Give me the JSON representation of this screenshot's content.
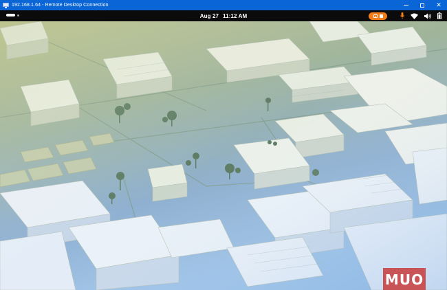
{
  "rdp_window": {
    "title": "192.168.1.64 - Remote Desktop Connection",
    "controls": {
      "minimize": "minimize",
      "maximize": "maximize",
      "close": "✕"
    }
  },
  "topbar": {
    "date": "Aug 27",
    "time": "11:12 AM",
    "tray": [
      "screen-record-indicator",
      "microphone-icon",
      "wifi-icon",
      "speaker-icon",
      "battery-icon"
    ]
  },
  "colors": {
    "titlebar": "#0a66d6",
    "topbar": "#0b0b0b",
    "record_indicator": "#f07d1a",
    "mic": "#f07d1a",
    "wallpaper_top": "#b7c28a",
    "wallpaper_bottom": "#8fb3de",
    "watermark": "#c83c3c"
  },
  "wallpaper": {
    "description_icon": "isometric-city-map"
  },
  "watermark": {
    "text": "MUO"
  }
}
